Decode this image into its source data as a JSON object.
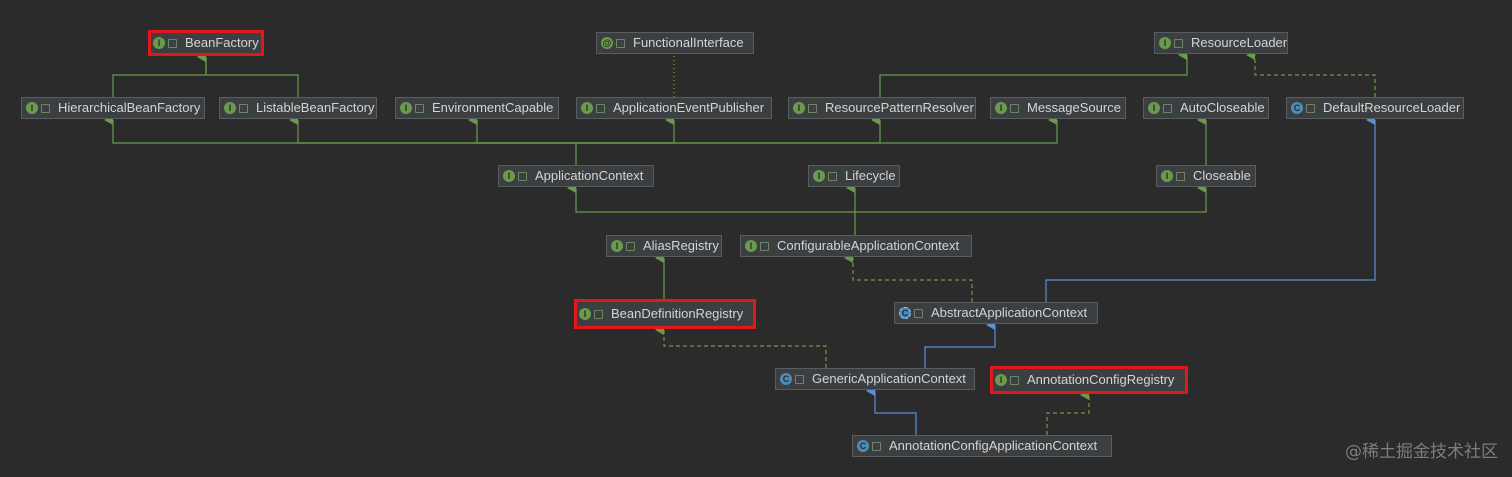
{
  "nodes": {
    "BeanFactory": {
      "label": "BeanFactory",
      "kind": "I",
      "highlighted": true
    },
    "FunctionalInterface": {
      "label": "FunctionalInterface",
      "kind": "@",
      "highlighted": false
    },
    "ResourceLoader": {
      "label": "ResourceLoader",
      "kind": "I",
      "highlighted": false
    },
    "HierarchicalBeanFactory": {
      "label": "HierarchicalBeanFactory",
      "kind": "I",
      "highlighted": false
    },
    "ListableBeanFactory": {
      "label": "ListableBeanFactory",
      "kind": "I",
      "highlighted": false
    },
    "EnvironmentCapable": {
      "label": "EnvironmentCapable",
      "kind": "I",
      "highlighted": false
    },
    "ApplicationEventPublisher": {
      "label": "ApplicationEventPublisher",
      "kind": "I",
      "highlighted": false
    },
    "ResourcePatternResolver": {
      "label": "ResourcePatternResolver",
      "kind": "I",
      "highlighted": false
    },
    "MessageSource": {
      "label": "MessageSource",
      "kind": "I",
      "highlighted": false
    },
    "AutoCloseable": {
      "label": "AutoCloseable",
      "kind": "I",
      "highlighted": false
    },
    "DefaultResourceLoader": {
      "label": "DefaultResourceLoader",
      "kind": "C",
      "highlighted": false
    },
    "ApplicationContext": {
      "label": "ApplicationContext",
      "kind": "I",
      "highlighted": false
    },
    "Lifecycle": {
      "label": "Lifecycle",
      "kind": "I",
      "highlighted": false
    },
    "Closeable": {
      "label": "Closeable",
      "kind": "I",
      "highlighted": false
    },
    "AliasRegistry": {
      "label": "AliasRegistry",
      "kind": "I",
      "highlighted": false
    },
    "ConfigurableApplicationContext": {
      "label": "ConfigurableApplicationContext",
      "kind": "I",
      "highlighted": false
    },
    "BeanDefinitionRegistry": {
      "label": "BeanDefinitionRegistry",
      "kind": "I",
      "highlighted": true
    },
    "AbstractApplicationContext": {
      "label": "AbstractApplicationContext",
      "kind": "A",
      "highlighted": false
    },
    "GenericApplicationContext": {
      "label": "GenericApplicationContext",
      "kind": "C",
      "highlighted": false
    },
    "AnnotationConfigRegistry": {
      "label": "AnnotationConfigRegistry",
      "kind": "I",
      "highlighted": true
    },
    "AnnotationConfigApplicationContext": {
      "label": "AnnotationConfigApplicationContext",
      "kind": "C",
      "highlighted": false
    }
  },
  "edges": [
    {
      "from": "HierarchicalBeanFactory",
      "to": "BeanFactory",
      "type": "extends"
    },
    {
      "from": "ListableBeanFactory",
      "to": "BeanFactory",
      "type": "extends"
    },
    {
      "from": "ApplicationEventPublisher",
      "to": "FunctionalInterface",
      "type": "annotated"
    },
    {
      "from": "ResourcePatternResolver",
      "to": "ResourceLoader",
      "type": "extends"
    },
    {
      "from": "DefaultResourceLoader",
      "to": "ResourceLoader",
      "type": "implements"
    },
    {
      "from": "ApplicationContext",
      "to": "HierarchicalBeanFactory",
      "type": "extends"
    },
    {
      "from": "ApplicationContext",
      "to": "ListableBeanFactory",
      "type": "extends"
    },
    {
      "from": "ApplicationContext",
      "to": "EnvironmentCapable",
      "type": "extends"
    },
    {
      "from": "ApplicationContext",
      "to": "ApplicationEventPublisher",
      "type": "extends"
    },
    {
      "from": "ApplicationContext",
      "to": "ResourcePatternResolver",
      "type": "extends"
    },
    {
      "from": "ApplicationContext",
      "to": "MessageSource",
      "type": "extends"
    },
    {
      "from": "Closeable",
      "to": "AutoCloseable",
      "type": "extends"
    },
    {
      "from": "ConfigurableApplicationContext",
      "to": "ApplicationContext",
      "type": "extends"
    },
    {
      "from": "ConfigurableApplicationContext",
      "to": "Lifecycle",
      "type": "extends"
    },
    {
      "from": "ConfigurableApplicationContext",
      "to": "Closeable",
      "type": "extends"
    },
    {
      "from": "BeanDefinitionRegistry",
      "to": "AliasRegistry",
      "type": "extends"
    },
    {
      "from": "AbstractApplicationContext",
      "to": "ConfigurableApplicationContext",
      "type": "implements"
    },
    {
      "from": "AbstractApplicationContext",
      "to": "DefaultResourceLoader",
      "type": "class-extends"
    },
    {
      "from": "GenericApplicationContext",
      "to": "AbstractApplicationContext",
      "type": "class-extends"
    },
    {
      "from": "GenericApplicationContext",
      "to": "BeanDefinitionRegistry",
      "type": "implements"
    },
    {
      "from": "AnnotationConfigApplicationContext",
      "to": "GenericApplicationContext",
      "type": "class-extends"
    },
    {
      "from": "AnnotationConfigApplicationContext",
      "to": "AnnotationConfigRegistry",
      "type": "implements"
    }
  ],
  "colors": {
    "background": "#2b2b2b",
    "interface_edge": "#6a9a4b",
    "class_edge": "#5b8fd6",
    "highlight": "#e3161a"
  },
  "watermark": "@稀土掘金技术社区"
}
